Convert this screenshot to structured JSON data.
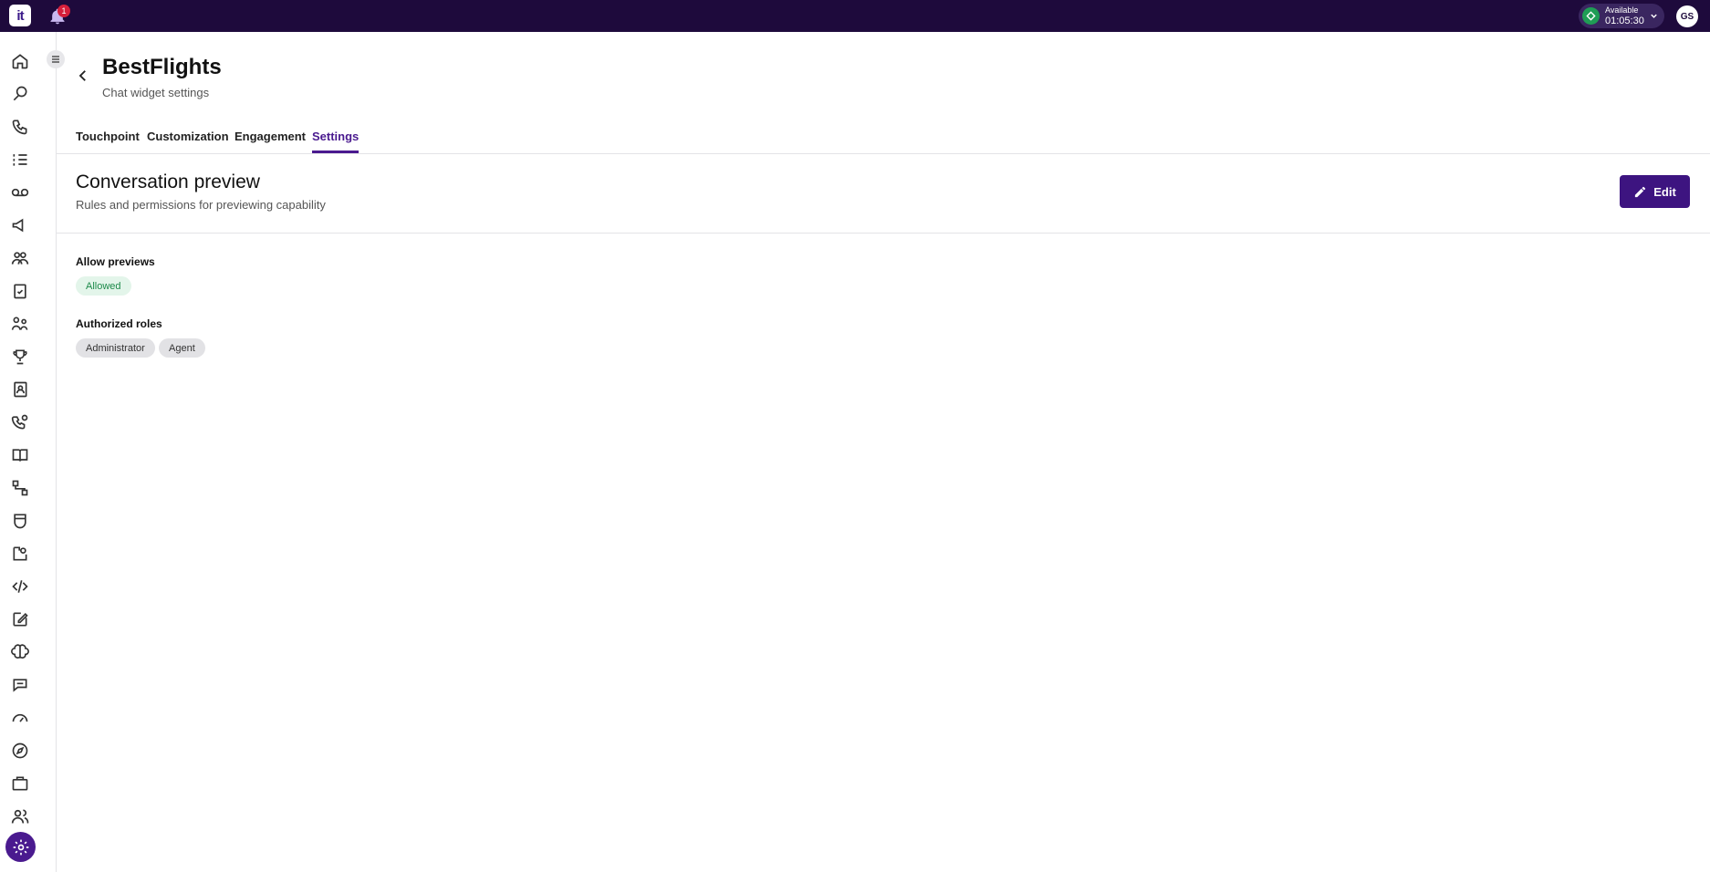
{
  "topbar": {
    "logo_text": "it",
    "notifications_count": "1",
    "status_label": "Available",
    "status_timer": "01:05:30",
    "avatar_initials": "GS"
  },
  "sidebar": {
    "icons": [
      "home-icon",
      "conversations-icon",
      "voice-icon",
      "tasks-list-icon",
      "voicemail-icon",
      "campaigns-icon",
      "people-icon",
      "checklist-icon",
      "team-icon",
      "trophy-icon",
      "contacts-icon",
      "call-routing-icon",
      "knowledge-icon",
      "flows-icon",
      "shield-icon",
      "integrations-icon",
      "code-icon",
      "edit-icon",
      "ai-brain-icon",
      "chat-icon",
      "speed-icon",
      "explore-icon",
      "briefcase-icon",
      "users-icon",
      "settings-icon"
    ],
    "active": "settings-icon"
  },
  "header": {
    "title": "BestFlights",
    "subtitle": "Chat widget settings"
  },
  "tabs": [
    {
      "label": "Touchpoint"
    },
    {
      "label": "Customization"
    },
    {
      "label": "Engagement"
    },
    {
      "label": "Settings"
    }
  ],
  "active_tab": "Settings",
  "section": {
    "title": "Conversation preview",
    "description": "Rules and permissions for previewing capability",
    "edit_label": "Edit"
  },
  "fields": {
    "allow_previews": {
      "label": "Allow previews",
      "value": "Allowed"
    },
    "authorized_roles": {
      "label": "Authorized roles",
      "values": [
        "Administrator",
        "Agent"
      ]
    }
  },
  "colors": {
    "topbar": "#1e0a3c",
    "accent": "#4a1a8f",
    "status_green": "#1f9d55"
  }
}
